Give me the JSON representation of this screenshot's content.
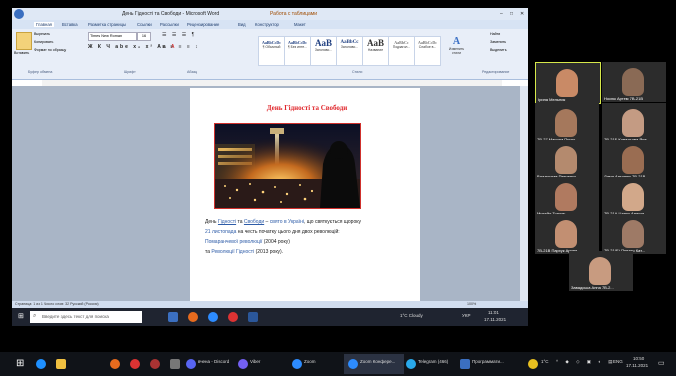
{
  "word": {
    "title": "День Гідності та Свободи - Microsoft Word",
    "context_tab": "Работа с таблицами",
    "tabs": [
      "Главная",
      "Вставка",
      "Разметка страницы",
      "Ссылки",
      "Рассылки",
      "Рецензирование",
      "Вид",
      "Конструктор",
      "Макет"
    ],
    "clipboard": [
      "Вырезать",
      "Копировать",
      "Формат по образцу"
    ],
    "paste_label": "Вставить",
    "font_name": "Times New Roman",
    "font_size": "16",
    "groups": [
      "Буфер обмена",
      "Шрифт",
      "Абзац",
      "Стили",
      "Редактирование"
    ],
    "styles": [
      {
        "sample": "AaBbCcDc",
        "name": "¶ Обычный"
      },
      {
        "sample": "AaBbCcDc",
        "name": "¶ Без инте..."
      },
      {
        "sample": "AaB",
        "name": "Заголово..."
      },
      {
        "sample": "AaBbCc",
        "name": "Заголово..."
      },
      {
        "sample": "AaB",
        "name": "Название"
      },
      {
        "sample": "AaBbCc",
        "name": "Подзагол..."
      },
      {
        "sample": "AaBbCcDc",
        "name": "Слабое в..."
      },
      {
        "sample": "AaBbCcDc",
        "name": "Изменить стили"
      }
    ],
    "editing": [
      "Найти",
      "Заменить",
      "Выделить"
    ],
    "doc_title": "День Гідності та Свободи",
    "para": [
      {
        "a": "День ",
        "b": "Гідності",
        "c": " та ",
        "d": "Свободи",
        "e": " – ",
        "f": "свято в Україні",
        "g": ", що святкується щороку"
      },
      {
        "a": "21 листопада",
        "b": " на честь початку цього дня двох революцій:"
      },
      {
        "a": "Помаранчевої революції",
        "b": " (2004 року)"
      },
      {
        "a": "та ",
        "b": "Революції Гідності",
        "c": " (2013 року)."
      }
    ],
    "status": "Страница: 1 из 1   Число слов: 32   Русский (Россия)",
    "zoom": "100%",
    "search_placeholder": "Введите здесь текст для поиска",
    "weather": "1°C Cloudy",
    "lang": "УКР",
    "time": "11:01",
    "date": "17.11.2021"
  },
  "participants": [
    {
      "name": "Ірина Мельник",
      "color": "#c98a66",
      "bg": "#3a3a3a"
    },
    {
      "name": "Носюк Артем 7В-21В",
      "color": "#8a6a55",
      "bg": "#4b4b4b"
    },
    {
      "name": "7В-27 Максим Приго...",
      "color": "#a5785c",
      "bg": "#3a3a3a"
    },
    {
      "name": "7В-21Б Ковальова Яна",
      "color": "#c49b83",
      "bg": "#2f2f2f"
    },
    {
      "name": "Владислав Петренко...",
      "color": "#b48a6e",
      "bg": "#3b3b3b"
    },
    {
      "name": "Дима Антонюк 7В-21В",
      "color": "#9a6d52",
      "bg": "#444"
    },
    {
      "name": "Михайл Тополь",
      "color": "#b07a60",
      "bg": "#3a3a3a"
    },
    {
      "name": "7В-21А Цапко Анаста...",
      "color": "#d2a88a",
      "bg": "#2e2e2e"
    },
    {
      "name": "7В-21В Пархук Арина",
      "color": "#c28f72",
      "bg": "#3d3d3d"
    },
    {
      "name": "7В-21(Б) Прядко Кат...",
      "color": "#9e7a66",
      "bg": "#4a4a4a"
    },
    {
      "name": "Завадська Анна 7В-2...",
      "color": "#c89b80",
      "bg": "#383838"
    }
  ],
  "taskbar": {
    "apps": [
      "вчена - Discord",
      "Viber",
      "Zoom",
      "Zoom Конфере...",
      "Telegram (466)",
      "Программати..."
    ],
    "temp": "1°C",
    "lang": "ENG",
    "time": "10:50",
    "date": "17.11.2021"
  },
  "colors": {
    "accent": "#2d8cff",
    "word_blue": "#2b579a",
    "title_red": "#e0262b"
  }
}
